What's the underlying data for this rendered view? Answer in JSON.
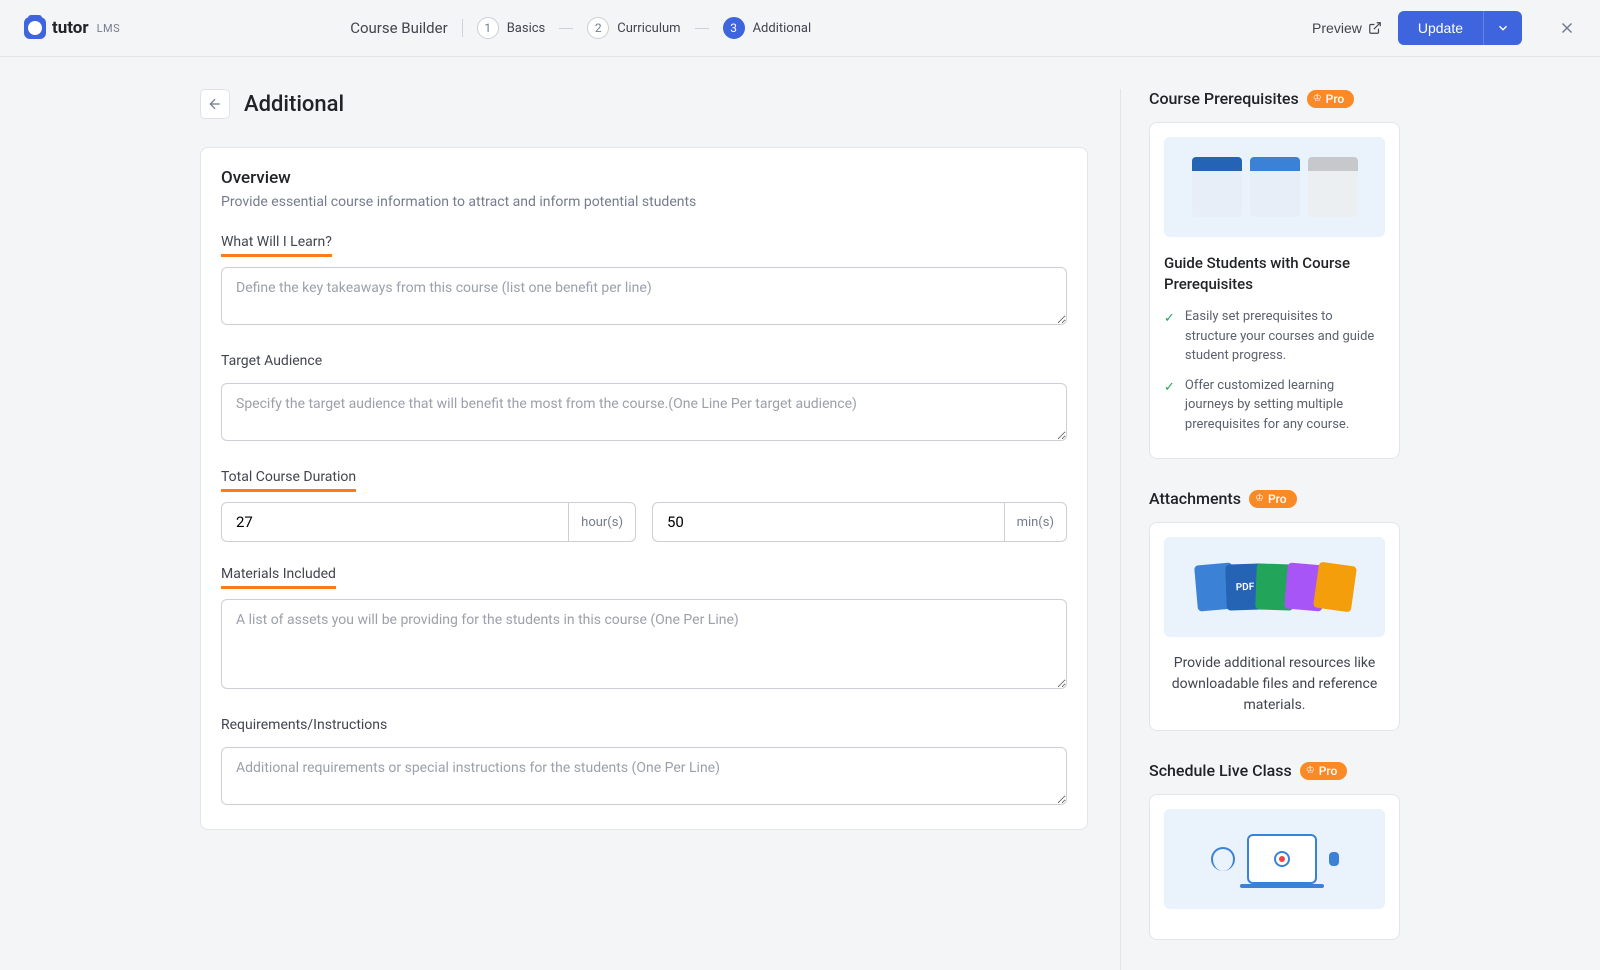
{
  "logo": {
    "name": "tutor",
    "suffix": "LMS"
  },
  "breadcrumb": {
    "title": "Course Builder",
    "steps": [
      {
        "num": "1",
        "label": "Basics"
      },
      {
        "num": "2",
        "label": "Curriculum"
      },
      {
        "num": "3",
        "label": "Additional"
      }
    ]
  },
  "actions": {
    "preview": "Preview",
    "update": "Update"
  },
  "page": {
    "title": "Additional"
  },
  "overview": {
    "title": "Overview",
    "subtitle": "Provide essential course information to attract and inform potential students",
    "learn_label": "What Will I Learn?",
    "learn_placeholder": "Define the key takeaways from this course (list one benefit per line)",
    "audience_label": "Target Audience",
    "audience_placeholder": "Specify the target audience that will benefit the most from the course.(One Line Per target audience)",
    "duration_label": "Total Course Duration",
    "hours_value": "27",
    "hours_unit": "hour(s)",
    "minutes_value": "50",
    "minutes_unit": "min(s)",
    "materials_label": "Materials Included",
    "materials_placeholder": "A list of assets you will be providing for the students in this course (One Per Line)",
    "requirements_label": "Requirements/Instructions",
    "requirements_placeholder": "Additional requirements or special instructions for the students (One Per Line)"
  },
  "sidebar": {
    "prereq": {
      "title": "Course Prerequisites",
      "badge": "Pro",
      "card_title": "Guide Students with Course Prerequisites",
      "points": [
        "Easily set prerequisites to structure your courses and guide student progress.",
        "Offer customized learning journeys by setting multiple prerequisites for any course."
      ]
    },
    "attachments": {
      "title": "Attachments",
      "badge": "Pro",
      "text": "Provide additional resources like downloadable files and reference materials."
    },
    "live": {
      "title": "Schedule Live Class",
      "badge": "Pro"
    }
  }
}
